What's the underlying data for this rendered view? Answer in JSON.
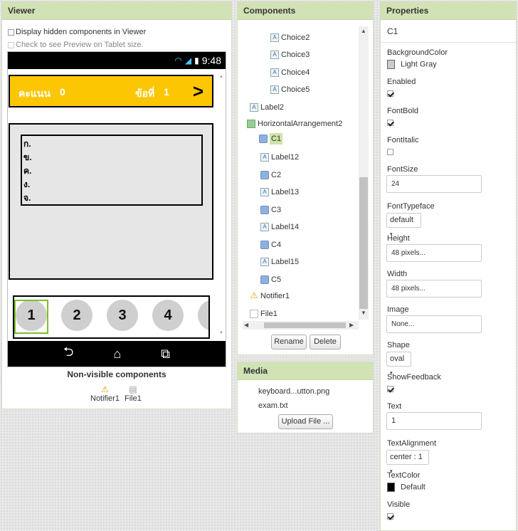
{
  "viewer": {
    "title": "Viewer",
    "display_hidden_label": "Display hidden components in Viewer",
    "tablet_preview_label": "Check to see Preview on Tablet size.",
    "status_time": "9:48",
    "score_label": "คะแนน",
    "score_value": "0",
    "question_label": "ข้อที่",
    "question_value": "1",
    "choices": [
      "ก.",
      "ข.",
      "ค.",
      "ง.",
      "จ."
    ],
    "number_buttons": [
      "1",
      "2",
      "3",
      "4"
    ],
    "nonvisible_title": "Non-visible components",
    "nonvisible": [
      "Notifier1",
      "File1"
    ]
  },
  "components": {
    "title": "Components",
    "tree": [
      "Choice2",
      "Choice3",
      "Choice4",
      "Choice5",
      "Label2",
      "HorizontalArrangement2",
      "C1",
      "Label12",
      "C2",
      "Label13",
      "C3",
      "Label14",
      "C4",
      "Label15",
      "C5",
      "Notifier1",
      "File1"
    ],
    "rename_label": "Rename",
    "delete_label": "Delete"
  },
  "media": {
    "title": "Media",
    "files": [
      "keyboard...utton.png",
      "exam.txt"
    ],
    "upload_label": "Upload File ..."
  },
  "properties": {
    "title": "Properties",
    "component": "C1",
    "background_color_label": "BackgroundColor",
    "background_color_value": "Light Gray",
    "enabled_label": "Enabled",
    "fontbold_label": "FontBold",
    "fontitalic_label": "FontItalic",
    "fontsize_label": "FontSize",
    "fontsize_value": "24",
    "fonttypeface_label": "FontTypeface",
    "fonttypeface_value": "default",
    "height_label": "Height",
    "height_value": "48 pixels...",
    "width_label": "Width",
    "width_value": "48 pixels...",
    "image_label": "Image",
    "image_value": "None...",
    "shape_label": "Shape",
    "shape_value": "oval",
    "showfeedback_label": "ShowFeedback",
    "text_label": "Text",
    "text_value": "1",
    "textalignment_label": "TextAlignment",
    "textalignment_value": "center : 1",
    "textcolor_label": "TextColor",
    "textcolor_value": "Default",
    "visible_label": "Visible",
    "enabled_checked": true,
    "fontbold_checked": true,
    "fontitalic_checked": false,
    "showfeedback_checked": true,
    "visible_checked": true
  },
  "colors": {
    "header_bg": "#d1e3b5",
    "topbar_bg": "#fdc602",
    "selection": "#7cc02d",
    "light_gray": "#cccccc",
    "text_color_default": "#000000"
  }
}
